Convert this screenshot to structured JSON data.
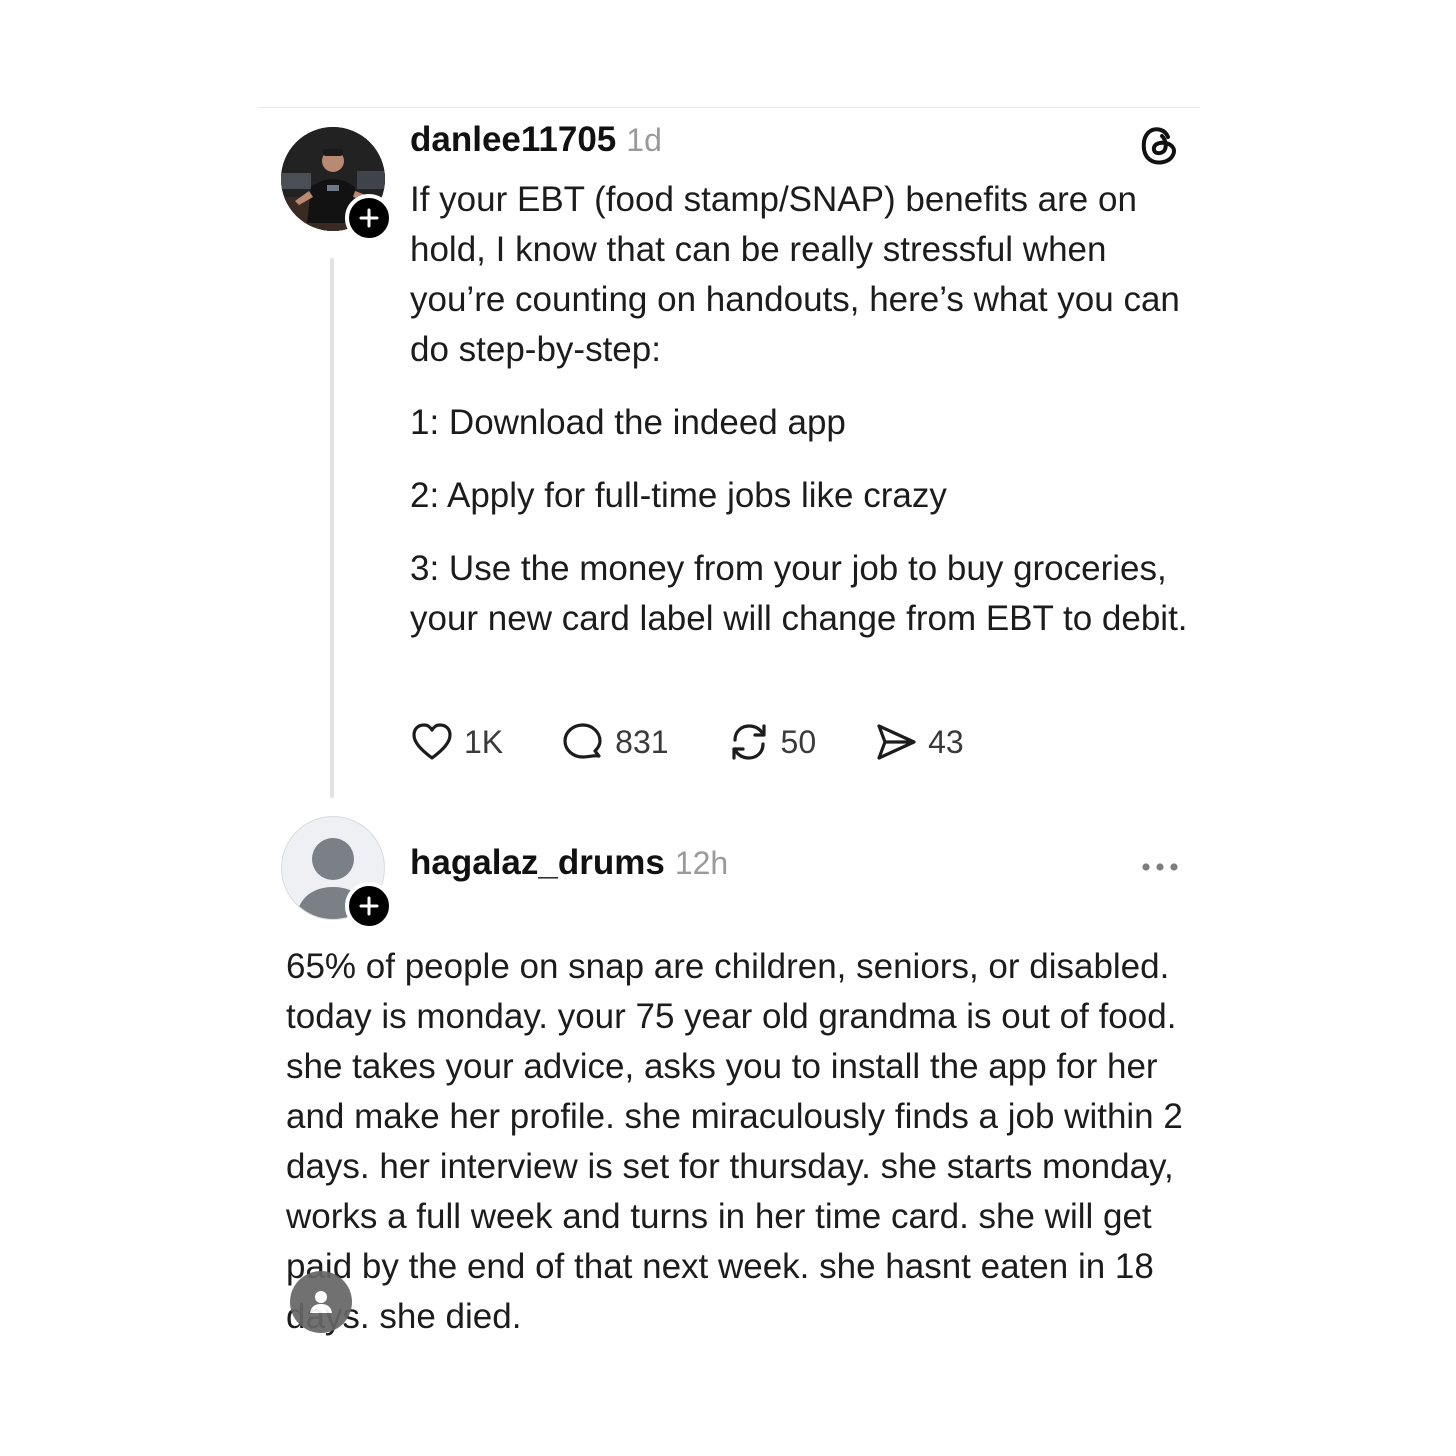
{
  "post": {
    "username": "danlee11705",
    "time": "1d",
    "paragraphs": [
      "If your EBT (food stamp/SNAP) benefits are on hold, I know that can be really stressful when you’re counting on handouts, here’s what you can do step-by-step:",
      "1: Download the indeed app",
      "2: Apply for full-time jobs like crazy",
      "3: Use the money from your job to buy groceries, your new card label will change from EBT to debit."
    ],
    "actions": {
      "likes": "1K",
      "comments": "831",
      "reposts": "50",
      "shares": "43"
    },
    "icons": [
      "heart-icon",
      "comment-icon",
      "repost-icon",
      "share-icon",
      "threads-logo-icon",
      "plus-icon"
    ]
  },
  "reply": {
    "username": "hagalaz_drums",
    "time": "12h",
    "text": "65% of people on snap are children, seniors, or disabled. today is monday. your 75 year old grandma is out of food.  she takes your advice, asks you to install the app for her and make her profile. she miraculously finds a job within 2 days. her interview is set for thursday. she starts monday, works a full week and turns in her time card. she will get paid by the end of that next week. she hasnt eaten in 18 days. she died.",
    "icons": [
      "more-icon",
      "default-avatar-icon",
      "plus-icon"
    ]
  },
  "colors": {
    "text": "#1c1c1c",
    "muted": "#9a9a9a",
    "thread_line": "#e3e3e3",
    "badge": "#000000"
  }
}
